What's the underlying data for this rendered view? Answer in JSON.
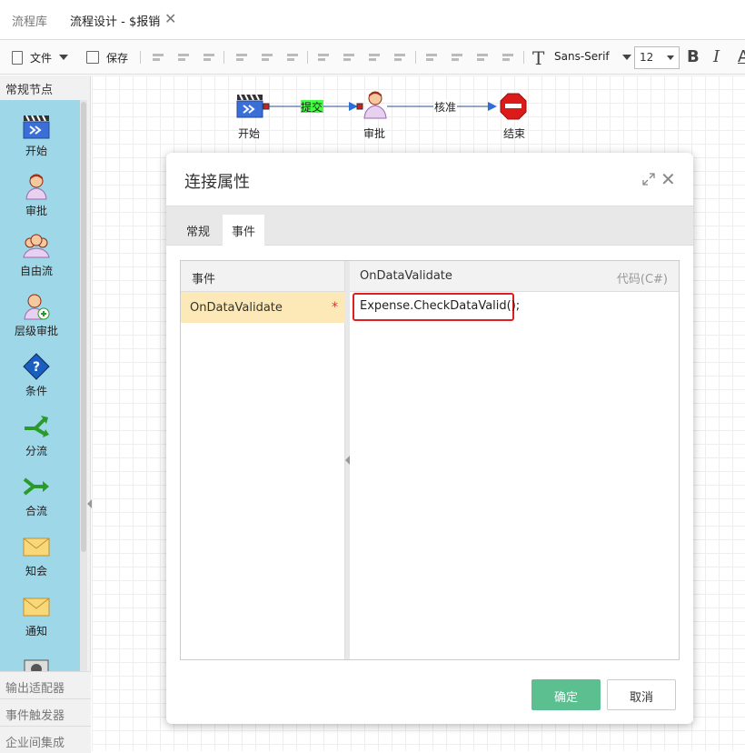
{
  "tabs": {
    "library": "流程库",
    "design": "流程设计 - $报销"
  },
  "toolbar": {
    "file": "文件",
    "save": "保存",
    "font_name": "Sans-Serif",
    "font_size": "12",
    "bold": "B",
    "italic": "I",
    "underline": "A",
    "font_glyph": "T"
  },
  "palette": {
    "header": "常规节点",
    "items": [
      {
        "label": "开始",
        "icon": "clapperboard-icon"
      },
      {
        "label": "审批",
        "icon": "user-icon"
      },
      {
        "label": "自由流",
        "icon": "users-icon"
      },
      {
        "label": "层级审批",
        "icon": "user-add-icon"
      },
      {
        "label": "条件",
        "icon": "question-diamond-icon"
      },
      {
        "label": "分流",
        "icon": "split-arrow-icon"
      },
      {
        "label": "合流",
        "icon": "merge-arrow-icon"
      },
      {
        "label": "知会",
        "icon": "envelope-icon"
      },
      {
        "label": "通知",
        "icon": "envelope-icon"
      }
    ],
    "footer": [
      "输出适配器",
      "事件触发器",
      "企业间集成"
    ]
  },
  "flow": {
    "nodes": [
      {
        "label": "开始",
        "icon": "clapperboard-icon"
      },
      {
        "label": "审批",
        "icon": "user-icon"
      },
      {
        "label": "结束",
        "icon": "stop-icon"
      }
    ],
    "edges": [
      {
        "label": "提交",
        "color": "#44ff44"
      },
      {
        "label": "核准",
        "color": ""
      }
    ]
  },
  "dialog": {
    "title": "连接属性",
    "tabs": [
      "常规",
      "事件"
    ],
    "active_tab": "事件",
    "events_header": "事件",
    "event_row": "OnDataValidate",
    "required_mark": "*",
    "code_header": "OnDataValidate",
    "code_lang": "代码(C#)",
    "code_value": "Expense.CheckDataValid();",
    "ok": "确定",
    "cancel": "取消"
  },
  "colors": {
    "accent_green": "#5bbf90",
    "palette_bg": "#9ed7e8",
    "row_highlight": "#fde9b8",
    "code_border": "#e02020"
  }
}
